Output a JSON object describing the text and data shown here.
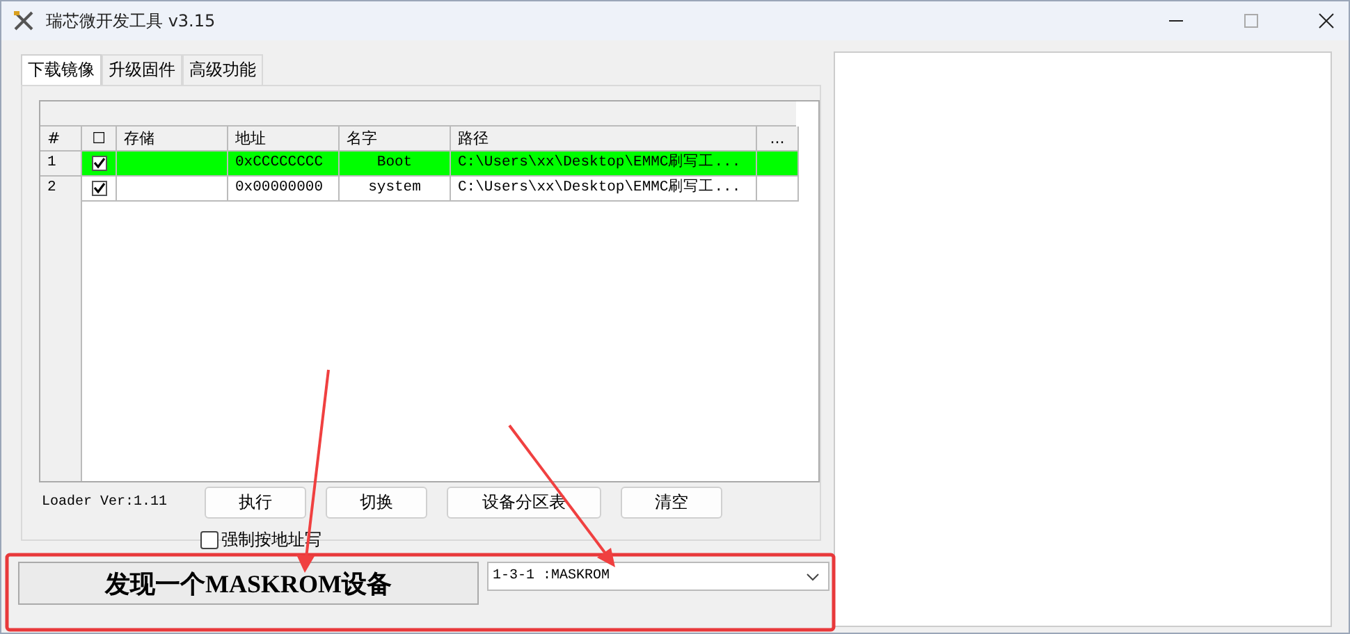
{
  "window": {
    "title": "瑞芯微开发工具 v3.15"
  },
  "tabs": [
    {
      "label": "下载镜像",
      "selected": true
    },
    {
      "label": "升级固件",
      "selected": false
    },
    {
      "label": "高级功能",
      "selected": false
    }
  ],
  "table": {
    "columns": [
      "#",
      "☐",
      "存储",
      "地址",
      "名字",
      "路径",
      "..."
    ],
    "rows": [
      {
        "index": "1",
        "checked": true,
        "selected": true,
        "address": "0xCCCCCCCC",
        "name": "Boot",
        "path": "C:\\Users\\xx\\Desktop\\EMMC刷写工..."
      },
      {
        "index": "2",
        "checked": true,
        "selected": false,
        "address": "0x00000000",
        "name": "system",
        "path": "C:\\Users\\xx\\Desktop\\EMMC刷写工..."
      }
    ]
  },
  "loader_version": "Loader Ver:1.11",
  "buttons": [
    "执行",
    "切换",
    "设备分区表",
    "清空"
  ],
  "force_address": {
    "label": "强制按地址写",
    "checked": false
  },
  "status": "发现一个MASKROM设备",
  "device_select": {
    "value": "1-3-1  :MASKROM"
  }
}
